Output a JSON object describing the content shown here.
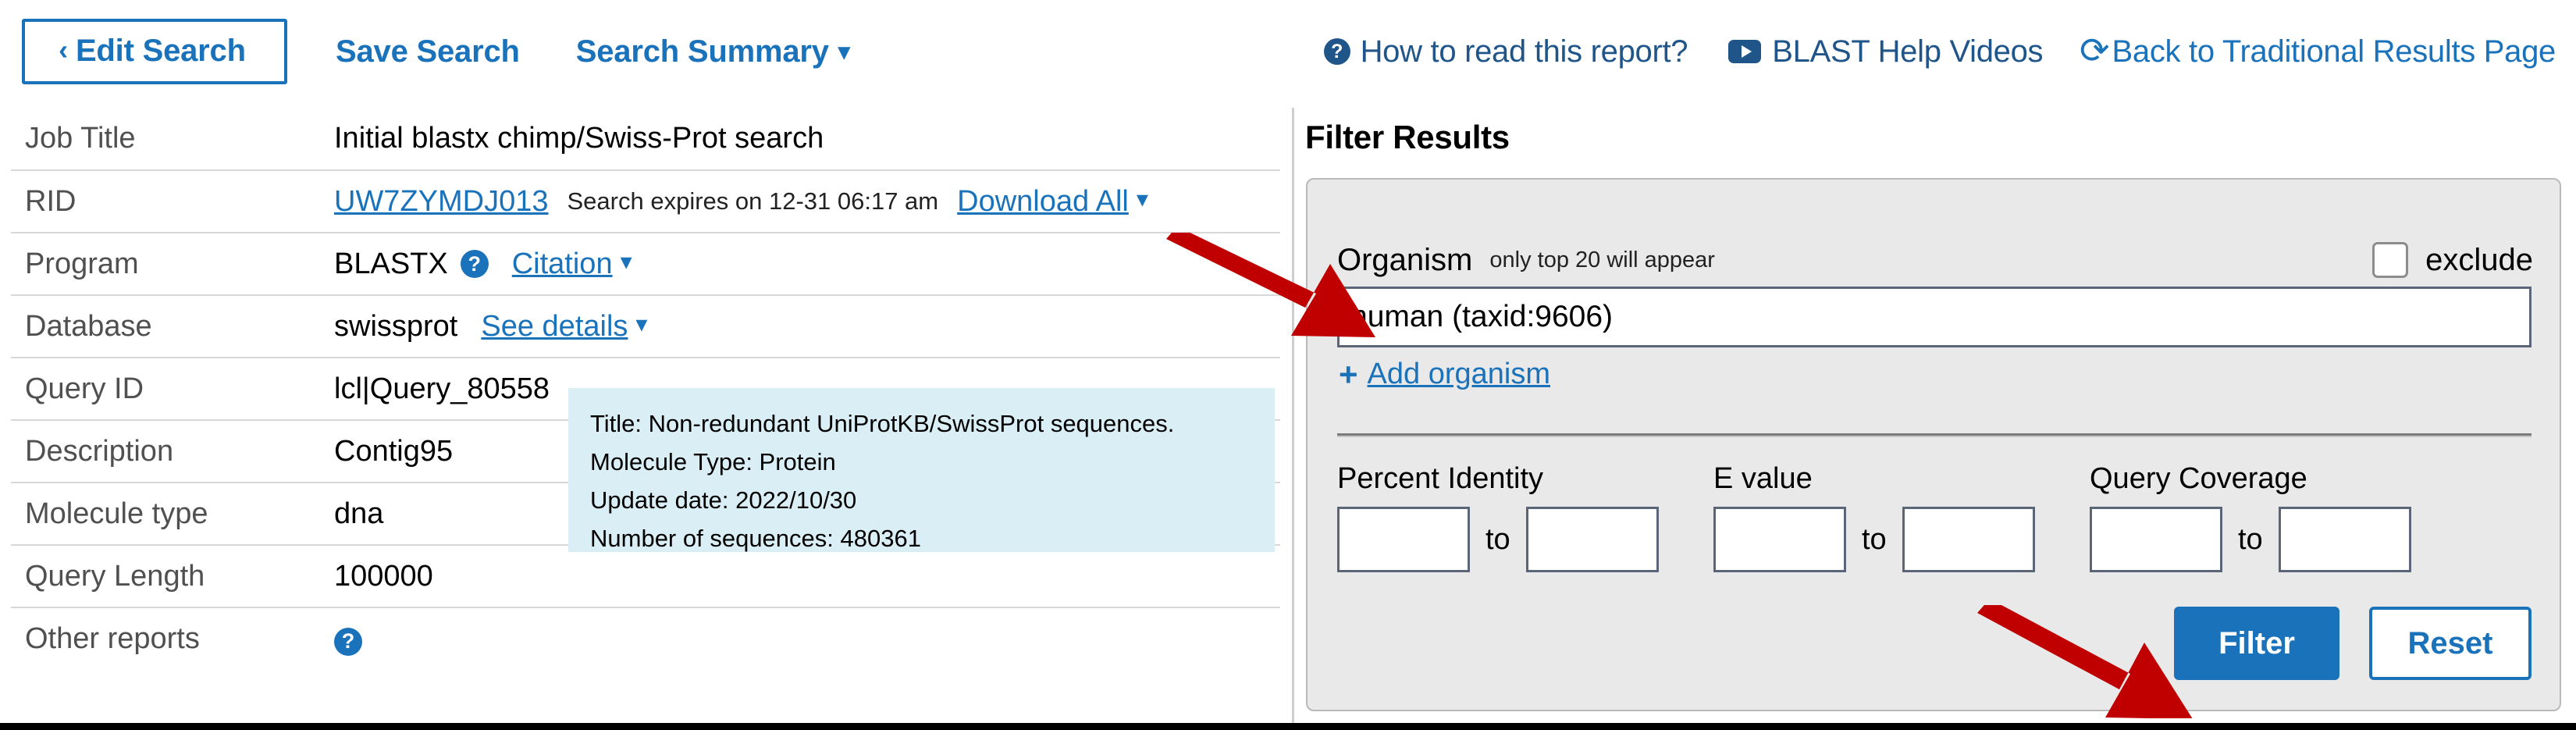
{
  "topnav": {
    "edit_search": "Edit Search",
    "save_search": "Save Search",
    "search_summary": "Search Summary",
    "how_to_read": "How to read this report?",
    "help_videos": "BLAST Help Videos",
    "back_traditional": "Back to Traditional Results Page",
    "chevron_left": "‹",
    "caret_down": "⌄",
    "qmark_glyph": "?",
    "undo_glyph": "↺",
    "link_color": "#1a72bb",
    "dark_link_color": "#20558a"
  },
  "info": {
    "rows": [
      {
        "label": "Job Title",
        "value": "Initial blastx chimp/Swiss-Prot search"
      },
      {
        "label": "RID",
        "value": "UW7ZYMDJ013"
      },
      {
        "label": "Program",
        "value": "BLASTX"
      },
      {
        "label": "Database",
        "value": "swissprot"
      },
      {
        "label": "Query ID",
        "value": "lcl|Query_80558"
      },
      {
        "label": "Description",
        "value": "Contig95"
      },
      {
        "label": "Molecule type",
        "value": "dna"
      },
      {
        "label": "Query Length",
        "value": "100000"
      },
      {
        "label": "Other reports",
        "value": ""
      }
    ],
    "rid_expiry": "Search expires on 12-31 06:17 am",
    "download_all": "Download All",
    "citation": "Citation",
    "see_details": "See details"
  },
  "db_tooltip": {
    "title": "Title:  Non-redundant UniProtKB/SwissProt sequences.",
    "molecule_type": "Molecule Type:  Protein",
    "update_date": "Update date:  2022/10/30",
    "num_sequences": "Number of sequences:  480361",
    "background": "#daeef5"
  },
  "filter": {
    "heading": "Filter Results",
    "organism_label": "Organism",
    "organism_hint": "only top 20 will appear",
    "exclude_label": "exclude",
    "exclude_checked": false,
    "organism_value": "human (taxid:9606)",
    "add_organism": "Add organism",
    "plus_glyph": "+",
    "percent_identity_label": "Percent Identity",
    "evalue_label": "E value",
    "query_coverage_label": "Query Coverage",
    "to_label": "to",
    "percent_identity_from": "",
    "percent_identity_to": "",
    "evalue_from": "",
    "evalue_to": "",
    "query_coverage_from": "",
    "query_coverage_to": "",
    "filter_button": "Filter",
    "reset_button": "Reset",
    "panel_background": "#e9e9e9",
    "primary_button_color": "#1a72bb"
  },
  "annotations": {
    "arrow_color": "#c00000",
    "arrow_1_target": "organism-input",
    "arrow_2_target": "filter-button"
  }
}
